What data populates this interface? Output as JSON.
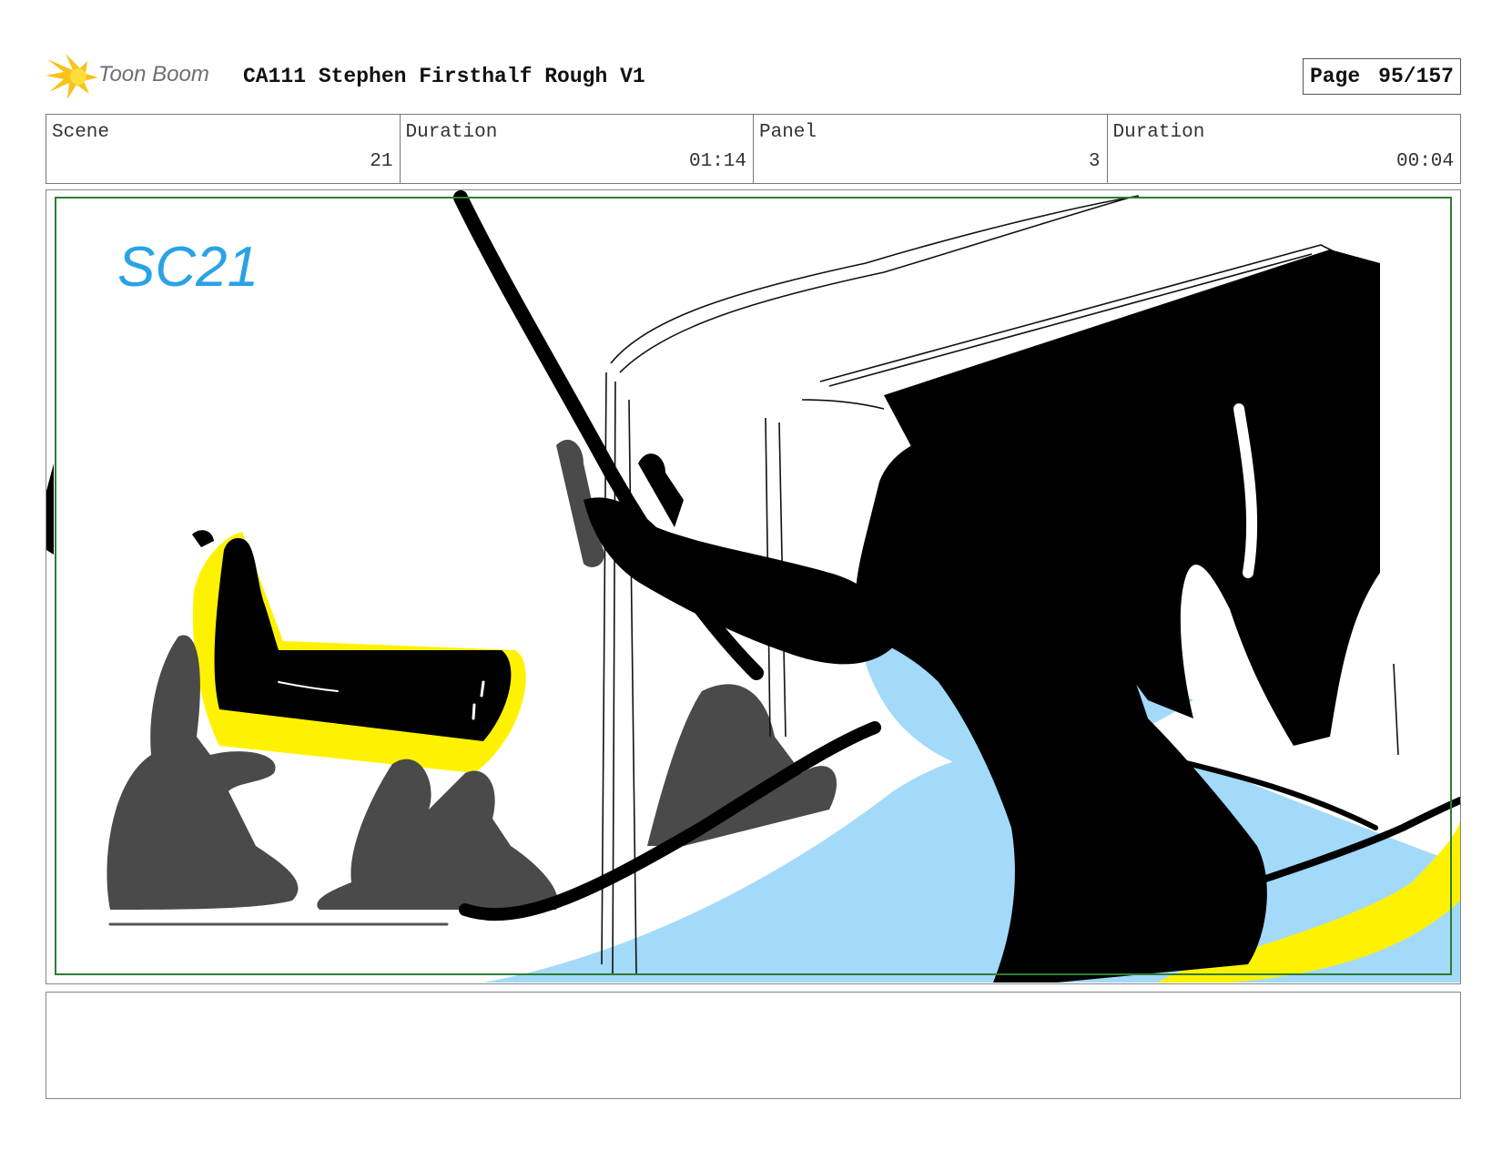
{
  "header": {
    "brand": "Toon Boom",
    "title": "CA111 Stephen Firsthalf Rough V1",
    "page_label": "Page",
    "page_number": "95/157"
  },
  "info": {
    "scene_label": "Scene",
    "scene_value": "21",
    "scene_duration_label": "Duration",
    "scene_duration_value": "01:14",
    "panel_label": "Panel",
    "panel_value": "3",
    "panel_duration_label": "Duration",
    "panel_duration_value": "00:04"
  },
  "panel": {
    "scene_marker": "SC21",
    "colors": {
      "safe_frame": "#2e7d32",
      "ink": "#000000",
      "shadow_gray": "#4a4a4a",
      "sky_blue": "#a3dafa",
      "highlight_yellow": "#fff200",
      "marker_blue": "#29a3e6"
    }
  },
  "notes": {
    "text": ""
  },
  "icons": {
    "logo": "toon-boom-star-logo"
  }
}
